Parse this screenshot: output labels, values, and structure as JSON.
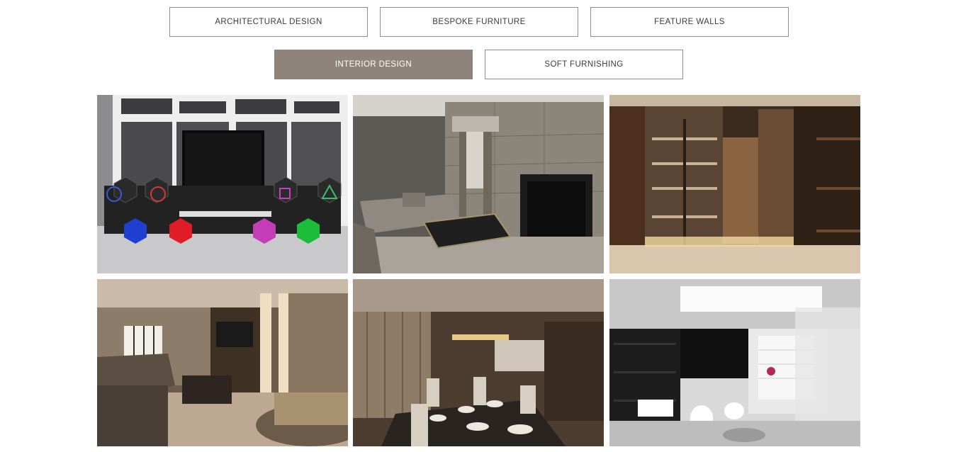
{
  "filters": {
    "architectural": "ARCHITECTURAL DESIGN",
    "furniture": "BESPOKE FURNITURE",
    "walls": "FEATURE WALLS",
    "interior": "INTERIOR DESIGN",
    "soft": "SOFT FURNISHING",
    "active": "INTERIOR DESIGN"
  },
  "colors": {
    "active_bg": "#8f847b",
    "border": "#8f8f8f",
    "text": "#3b3b3b"
  },
  "gallery": [
    {
      "icon": "games-room-image"
    },
    {
      "icon": "living-room-image"
    },
    {
      "icon": "dressing-room-image"
    },
    {
      "icon": "lounge-image"
    },
    {
      "icon": "dining-room-image"
    },
    {
      "icon": "bathroom-image"
    }
  ]
}
